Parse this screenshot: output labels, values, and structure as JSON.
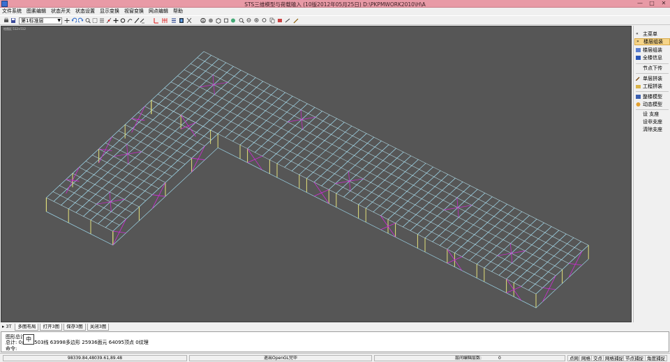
{
  "window": {
    "title": "STS三维模型与荷载输入 (10版2012年05月25日)  D:\\PKPMWORK2010\\H\\A",
    "min_label": "—",
    "max_label": "□",
    "close_label": "✕"
  },
  "menubar": {
    "items": [
      "文件系统",
      "图素编辑",
      "状态开关",
      "状态设置",
      "显示变换",
      "视窗变换",
      "网点编辑",
      "帮助"
    ]
  },
  "toolbar": {
    "layer_select_value": "第1标准层",
    "icons": [
      "printer-icon",
      "save-icon",
      "undo-icon",
      "redo-icon",
      "zoom-in-icon",
      "zoom-out-icon",
      "rotate-icon",
      "pan-icon",
      "grid-icon",
      "snap-icon",
      "ortho-icon",
      "red-column-icon",
      "red-beam-icon",
      "layer-icon",
      "brace-icon",
      "view-3d-icon",
      "render-icon",
      "cube-icon",
      "iso-icon",
      "color-icon",
      "zoom-window-icon",
      "zoom-all-icon",
      "zoom-prev-icon",
      "measure-icon",
      "copy-icon",
      "paint-icon",
      "edit-icon"
    ]
  },
  "viewport": {
    "label": "绘图区 512×512"
  },
  "rightpanel": {
    "items": [
      {
        "label": "主菜单",
        "icon": "double-chevron-up-icon",
        "selected": false
      },
      {
        "label": "楼层组装",
        "icon": "double-chevron-down-icon",
        "selected": true
      },
      {
        "label": "楼层组装",
        "icon": "layers-icon",
        "selected": false
      },
      {
        "label": "全楼信息",
        "icon": "info-icon",
        "selected": false
      },
      {
        "label": "节点下传",
        "icon": "",
        "selected": false
      },
      {
        "label": "单层拼装",
        "icon": "hammer-icon",
        "selected": false
      },
      {
        "label": "工程拼装",
        "icon": "folder-icon",
        "selected": false
      },
      {
        "label": "整楼模型",
        "icon": "building-icon",
        "selected": false
      },
      {
        "label": "动态模型",
        "icon": "sphere-icon",
        "selected": false
      },
      {
        "label": "设 支座",
        "icon": "",
        "selected": false
      },
      {
        "label": "设非支座",
        "icon": "",
        "selected": false
      },
      {
        "label": "清除支座",
        "icon": "",
        "selected": false
      }
    ]
  },
  "tabs": [
    "▸ 3T",
    "多图布局",
    "打开3图",
    "保存3图",
    "关闭3图"
  ],
  "command": {
    "line1": "图形总计: 1",
    "line2": "总计:    0点    19503线    63998多边形    25936面元    64095顶点    0纹理",
    "line3": "命令:",
    "ime": "中"
  },
  "statusbar": {
    "coords": "98339.84,48039.61,89.48",
    "message": "退出OpenGL完毕",
    "grid_label": "层间编辑层数:",
    "grid_value": "0",
    "buttons": [
      "点网",
      "网格",
      "交点",
      "网格捕捉",
      "节点捕捉",
      "角度捕捉"
    ]
  }
}
